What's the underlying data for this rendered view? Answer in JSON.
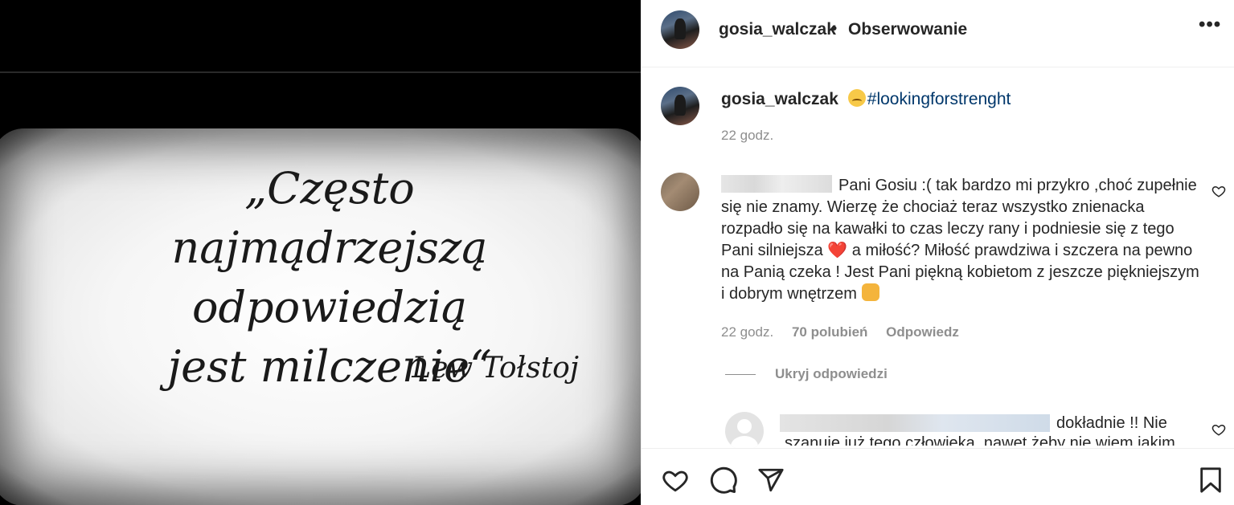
{
  "post_image": {
    "quote_lines": [
      "„Często najmądrzejszą",
      "odpowiedzią",
      "jest milczenie“"
    ],
    "author": "Lew Tołstoj"
  },
  "header": {
    "username": "gosia_walczak",
    "separator": "•",
    "follow_label": "Obserwowanie",
    "more_label": "•••"
  },
  "caption": {
    "username": "gosia_walczak",
    "emoji_icon": "pensive-face-icon",
    "hashtag": "#lookingforstrenght",
    "time": "22 godz."
  },
  "comment": {
    "text_before_heart": "Pani Gosiu :( tak bardzo mi przykro ,choć zupełnie się nie znamy. Wierzę że chociaż teraz wszystko znienacka rozpadło się na kawałki to czas leczy rany i podniesie się z tego Pani silniejsza",
    "heart_emoji": "❤️",
    "text_after_heart": " a miłość? Miłość prawdziwa i szczera na pewno na Panią czeka ! Jest Pani piękną kobietom z jeszcze piękniejszym i dobrym wnętrzem",
    "hands_emoji_icon": "raising-hands-icon",
    "time": "22 godz.",
    "likes": "70 polubień",
    "reply_label": "Odpowiedz",
    "hide_replies_label": "Ukryj odpowiedzi"
  },
  "reply": {
    "text_start": "dokładnie !! Nie",
    "text_cut": "szanuje już tego człowieka, nawet żeby nie wiem jakim"
  },
  "actions": {
    "like_icon": "heart-icon",
    "comment_icon": "comment-icon",
    "share_icon": "share-icon",
    "save_icon": "bookmark-icon"
  }
}
